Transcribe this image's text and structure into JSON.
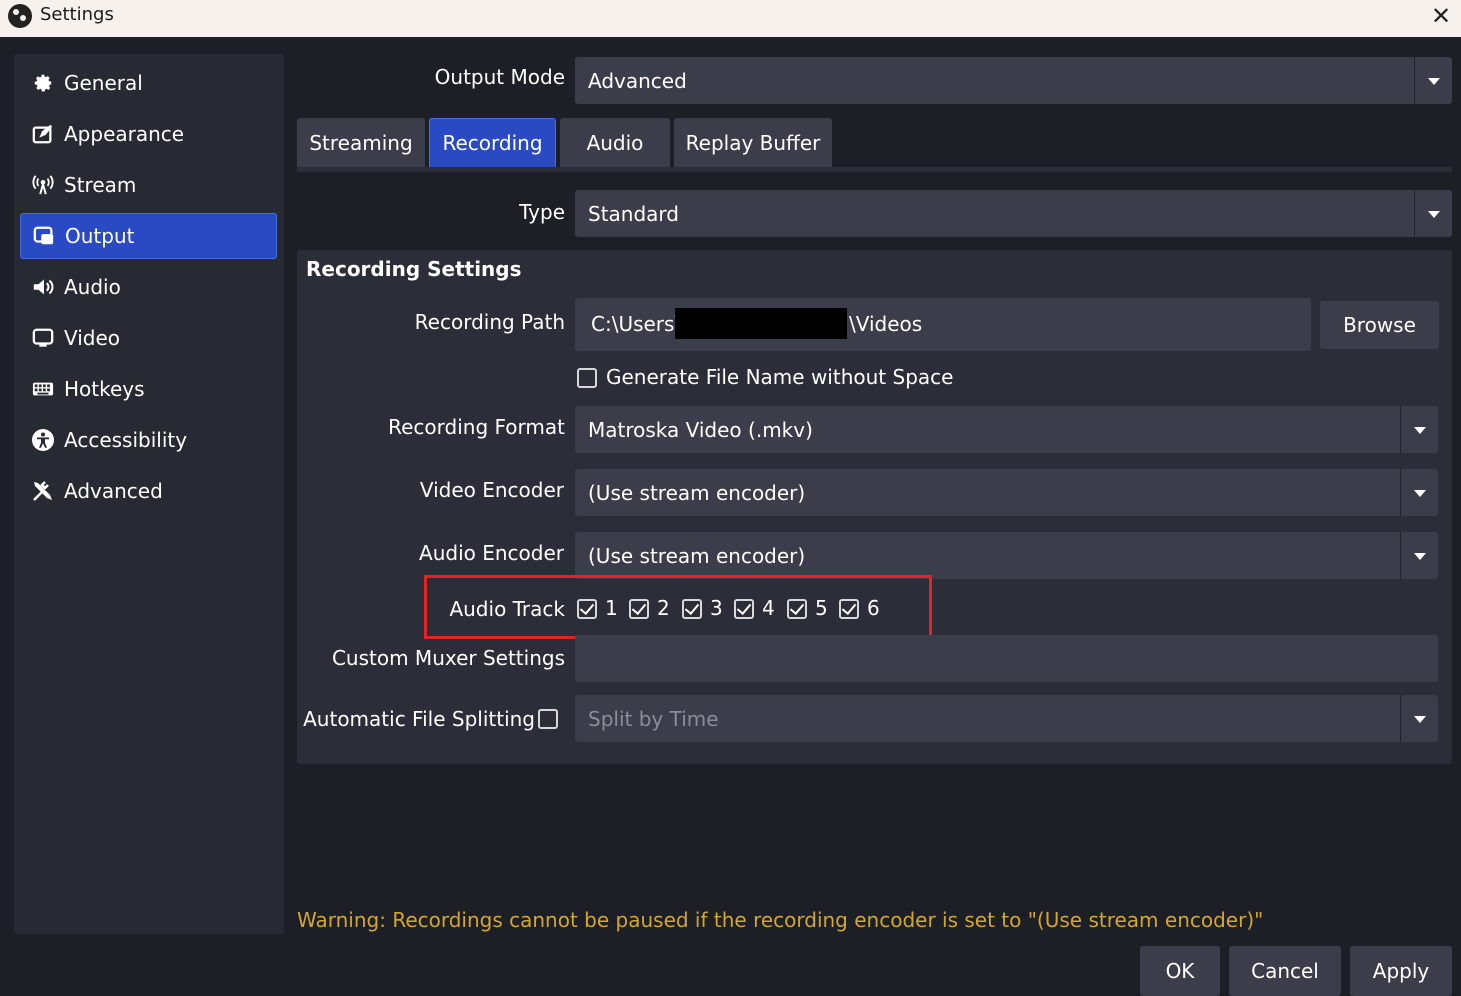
{
  "window": {
    "title": "Settings",
    "close_icon": "close-icon"
  },
  "sidebar": {
    "items": [
      {
        "label": "General",
        "icon": "gear-icon",
        "active": false
      },
      {
        "label": "Appearance",
        "icon": "appearance-icon",
        "active": false
      },
      {
        "label": "Stream",
        "icon": "antenna-icon",
        "active": false
      },
      {
        "label": "Output",
        "icon": "output-icon",
        "active": true
      },
      {
        "label": "Audio",
        "icon": "speaker-icon",
        "active": false
      },
      {
        "label": "Video",
        "icon": "monitor-icon",
        "active": false
      },
      {
        "label": "Hotkeys",
        "icon": "keyboard-icon",
        "active": false
      },
      {
        "label": "Accessibility",
        "icon": "accessibility-icon",
        "active": false
      },
      {
        "label": "Advanced",
        "icon": "tools-icon",
        "active": false
      }
    ]
  },
  "output_mode": {
    "label": "Output Mode",
    "value": "Advanced"
  },
  "tabs": [
    {
      "label": "Streaming",
      "active": false
    },
    {
      "label": "Recording",
      "active": true
    },
    {
      "label": "Audio",
      "active": false
    },
    {
      "label": "Replay Buffer",
      "active": false
    }
  ],
  "type": {
    "label": "Type",
    "value": "Standard"
  },
  "recording_settings": {
    "title": "Recording Settings",
    "path": {
      "label": "Recording Path",
      "value_prefix": "C:\\Users\\",
      "value_suffix": "\\Videos",
      "browse_label": "Browse"
    },
    "generate_filename": {
      "label": "Generate File Name without Space",
      "checked": false
    },
    "format": {
      "label": "Recording Format",
      "value": "Matroska Video (.mkv)"
    },
    "video_encoder": {
      "label": "Video Encoder",
      "value": "(Use stream encoder)"
    },
    "audio_encoder": {
      "label": "Audio Encoder",
      "value": "(Use stream encoder)"
    },
    "audio_track": {
      "label": "Audio Track",
      "tracks": [
        {
          "label": "1",
          "checked": true
        },
        {
          "label": "2",
          "checked": true
        },
        {
          "label": "3",
          "checked": true
        },
        {
          "label": "4",
          "checked": true
        },
        {
          "label": "5",
          "checked": true
        },
        {
          "label": "6",
          "checked": true
        }
      ]
    },
    "custom_muxer": {
      "label": "Custom Muxer Settings",
      "value": ""
    },
    "auto_split": {
      "label": "Automatic File Splitting",
      "checked": false,
      "value": "Split by Time"
    }
  },
  "warning": "Warning: Recordings cannot be paused if the recording encoder is set to \"(Use stream encoder)\"",
  "footer": {
    "ok_label": "OK",
    "cancel_label": "Cancel",
    "apply_label": "Apply"
  },
  "colors": {
    "accent": "#2a4ac4",
    "background": "#1d1f26",
    "panel": "#2b2e38",
    "field": "#3b3e4a",
    "warning": "#d4a531",
    "highlight": "#e02323"
  }
}
